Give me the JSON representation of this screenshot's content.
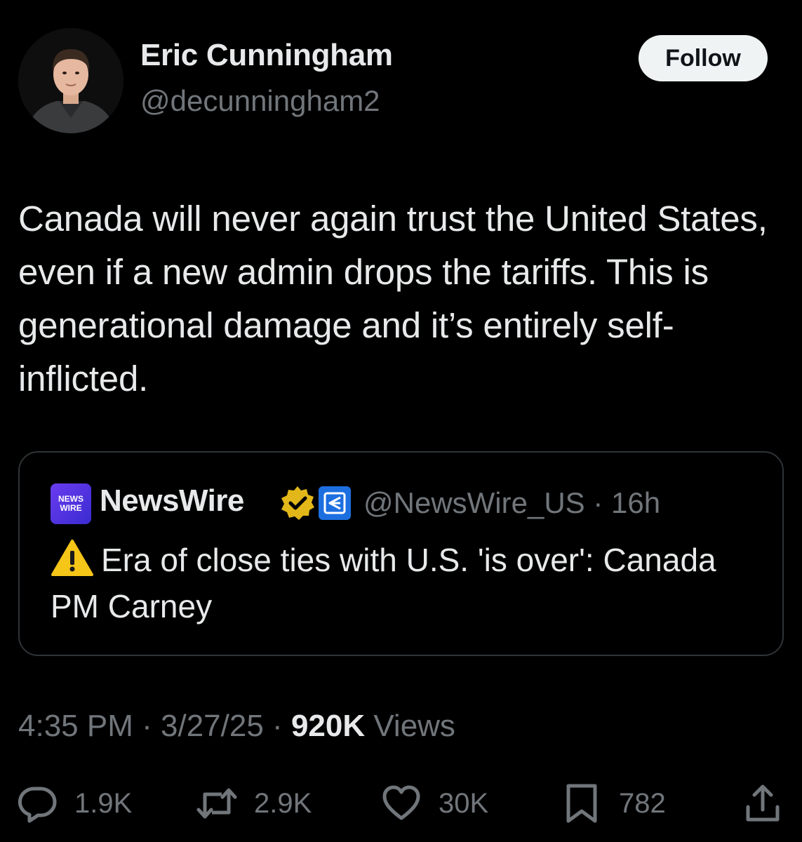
{
  "author": {
    "display_name": "Eric Cunningham",
    "handle": "@decunningham2",
    "follow_label": "Follow"
  },
  "tweet": {
    "text": "Canada will never again trust the United States, even if a new admin drops the tariffs. This is generational damage and it’s entirely self-inflicted."
  },
  "quote": {
    "logo_text_line1": "NEWS",
    "logo_text_line2": "WIRE",
    "name": "NewsWire",
    "handle": "@NewsWire_US",
    "separator": "·",
    "time": "16h",
    "text": "Era of close ties with U.S. 'is over': Canada PM Carney"
  },
  "meta": {
    "time": "4:35 PM",
    "separator": "·",
    "date": "3/27/25",
    "views_count": "920K",
    "views_label": "Views"
  },
  "actions": {
    "replies": "1.9K",
    "reposts": "2.9K",
    "likes": "30K",
    "bookmarks": "782"
  },
  "icons": {
    "reply": "reply-icon",
    "repost": "repost-icon",
    "like": "heart-icon",
    "bookmark": "bookmark-icon",
    "share": "share-icon",
    "verified": "verified-gold-icon",
    "warning": "warning-icon"
  },
  "colors": {
    "background": "#000000",
    "text_primary": "#e7e9ea",
    "text_secondary": "#71767b",
    "border": "#2f3336",
    "verified_gold": "#e2b719",
    "affiliate_blue": "#1d6fe0"
  }
}
